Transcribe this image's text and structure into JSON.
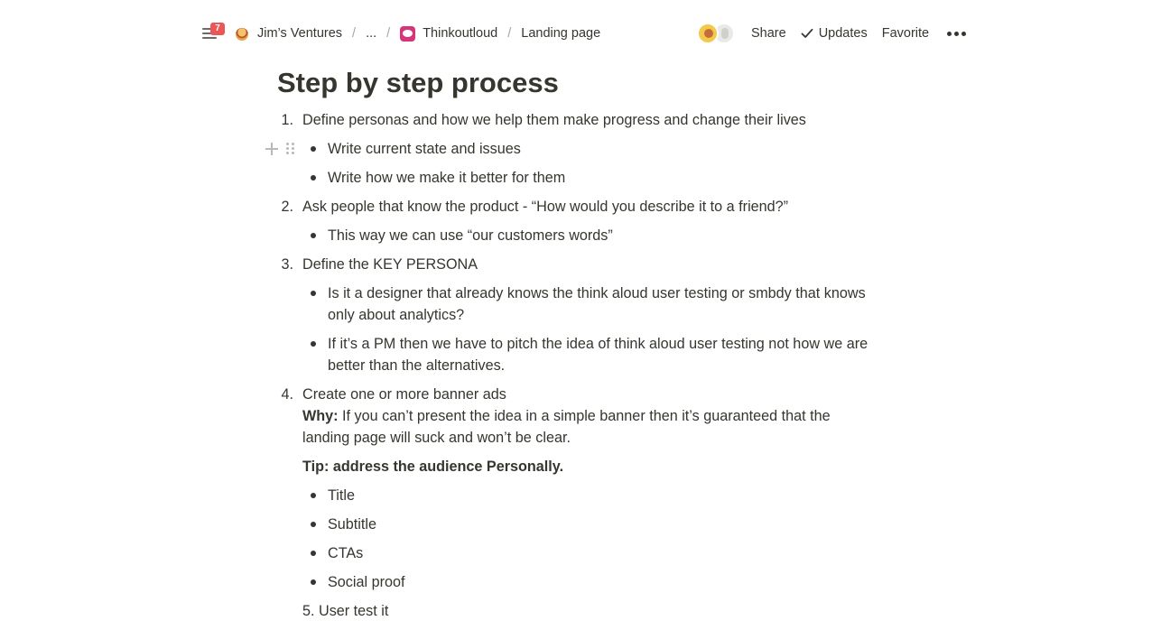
{
  "topbar": {
    "notification_count": "7",
    "breadcrumbs": [
      {
        "label": "Jim’s Ventures",
        "icon": "burger-emoji-icon"
      },
      {
        "label": "...",
        "icon": ""
      },
      {
        "label": "Thinkoutloud",
        "icon": "speech-bubble-icon"
      },
      {
        "label": "Landing page",
        "icon": ""
      }
    ],
    "separator": "/",
    "share_label": "Share",
    "updates_label": "Updates",
    "favorite_label": "Favorite"
  },
  "doc": {
    "title": "Step by step process",
    "step1": {
      "num": "1.",
      "text": "Define personas and how we help them make progress and change their lives",
      "bullets": [
        "Write current state and issues",
        "Write how we make it better for them"
      ]
    },
    "step2": {
      "num": "2.",
      "text": "Ask people that know the product - “How would you describe it to a friend?”",
      "bullets": [
        "This way we can use “our customers words”"
      ]
    },
    "step3": {
      "num": "3.",
      "text": "Define the KEY PERSONA",
      "bullet1_line1": "Is it a designer that already knows the think aloud user testing or smbdy that knows",
      "bullet1_line2": "only about analytics?",
      "bullet2_line1": "If it’s a PM then we have to pitch the idea of think aloud user testing not how we are",
      "bullet2_line2": "better than the alternatives."
    },
    "step4": {
      "num": "4.",
      "text": "Create one or more banner ads",
      "why_label": "Why:",
      "why_line1": " If you can’t present the idea in a simple banner then it’s guaranteed that the",
      "why_line2": "landing page will suck and won’t be clear.",
      "tip": "Tip: address the audience Personally.",
      "bullets": [
        "Title",
        "Subtitle",
        "CTAs",
        "Social proof"
      ]
    },
    "step5": "5. User test it"
  }
}
